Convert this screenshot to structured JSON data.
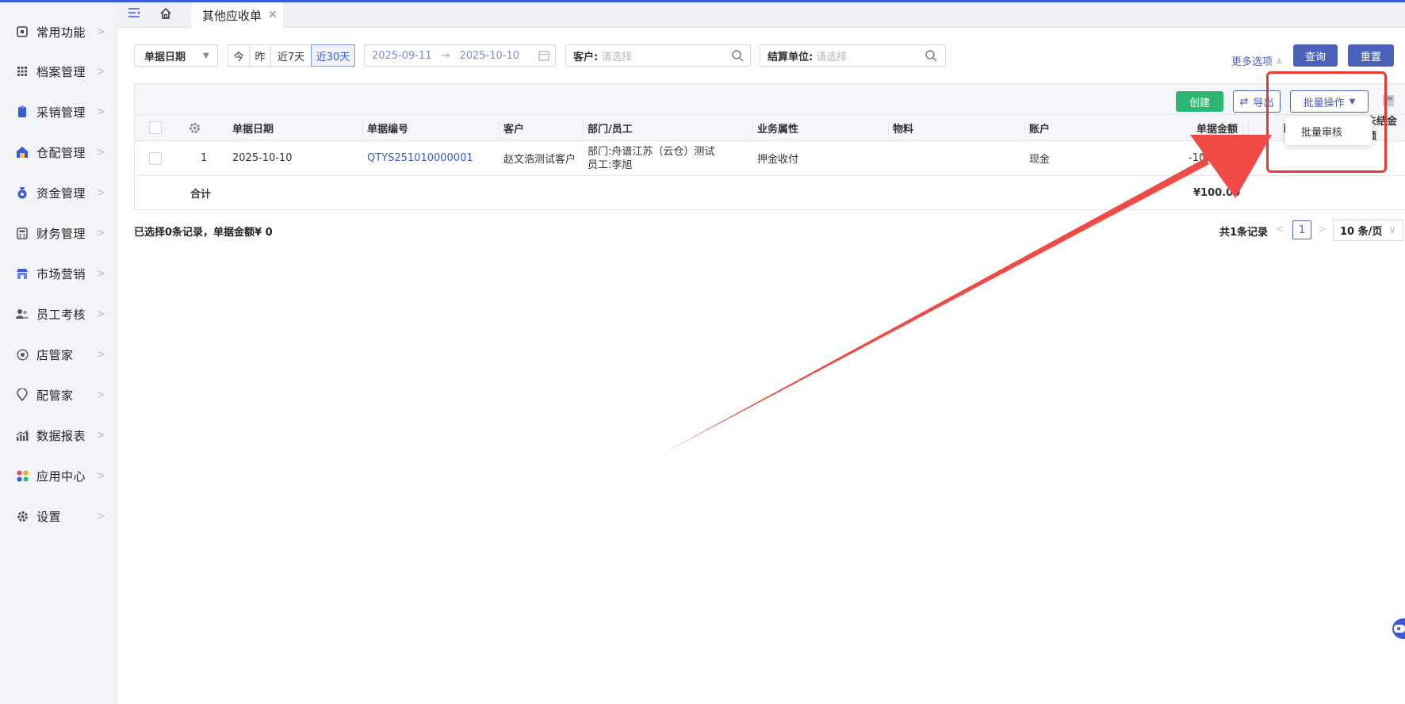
{
  "sidebar": {
    "items": [
      {
        "label": "常用功能",
        "icon": "monitor-icon"
      },
      {
        "label": "档案管理",
        "icon": "archive-icon"
      },
      {
        "label": "采销管理",
        "icon": "clipboard-icon"
      },
      {
        "label": "仓配管理",
        "icon": "warehouse-icon"
      },
      {
        "label": "资金管理",
        "icon": "money-bag-icon"
      },
      {
        "label": "财务管理",
        "icon": "calculator-icon"
      },
      {
        "label": "市场营销",
        "icon": "store-icon"
      },
      {
        "label": "员工考核",
        "icon": "users-icon"
      },
      {
        "label": "店管家",
        "icon": "shop-manager-icon"
      },
      {
        "label": "配管家",
        "icon": "location-icon"
      },
      {
        "label": "数据报表",
        "icon": "chart-icon"
      },
      {
        "label": "应用中心",
        "icon": "apps-icon"
      },
      {
        "label": "设置",
        "icon": "gear-icon"
      }
    ]
  },
  "tabs": {
    "active_label": "其他应收单"
  },
  "filters": {
    "date_type": "单据日期",
    "quick": [
      "今",
      "昨",
      "近7天",
      "近30天"
    ],
    "date_start": "2025-09-11",
    "date_end": "2025-10-10",
    "customer_label": "客户:",
    "customer_placeholder": "请选择",
    "settle_label": "结算单位:",
    "settle_placeholder": "请选择",
    "more": "更多选项",
    "query": "查询",
    "reset": "重置"
  },
  "toolbar": {
    "create": "创建",
    "export": "导出",
    "batch": "批量操作",
    "batch_menu": [
      "批量审核"
    ]
  },
  "table": {
    "headers": [
      "单据日期",
      "单据编号",
      "客户",
      "部门/员工",
      "业务属性",
      "物料",
      "账户",
      "单据金额",
      "已",
      "未结金额"
    ],
    "rows": [
      {
        "index": "1",
        "date": "2025-10-10",
        "code": "QTYS251010000001",
        "customer": "赵文浩测试客户",
        "dept_line1": "部门:舟谱江苏（云仓）测试",
        "dept_line2": "员工:李旭",
        "biz": "押金收付",
        "material": "",
        "account": "现金",
        "amount": "-100.00"
      }
    ],
    "total_label": "合计",
    "total_amount": "¥100.00"
  },
  "summary": "已选择0条记录，单据金额¥ 0",
  "pager": {
    "total": "共1条记录",
    "current": "1",
    "size": "10 条/页"
  }
}
